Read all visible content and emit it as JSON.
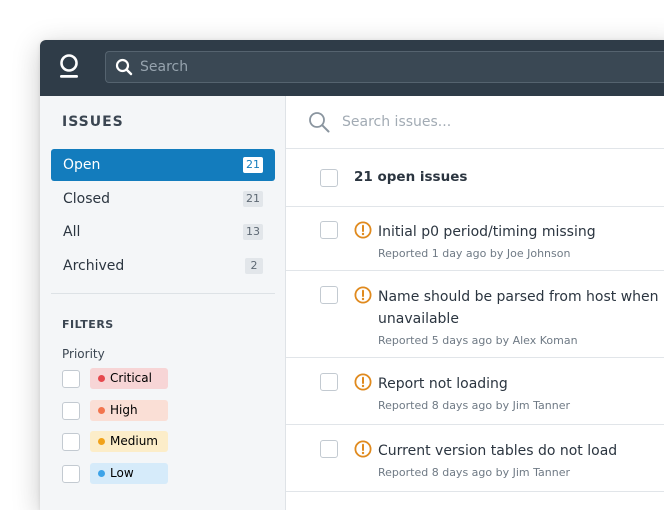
{
  "topbar": {
    "search_placeholder": "Search",
    "logo_icon": "app-logo-icon",
    "search_icon": "search-icon"
  },
  "sidebar": {
    "heading": "ISSUES",
    "nav": [
      {
        "label": "Open",
        "count": "21",
        "active": true
      },
      {
        "label": "Closed",
        "count": "21",
        "active": false
      },
      {
        "label": "All",
        "count": "13",
        "active": false
      },
      {
        "label": "Archived",
        "count": "2",
        "active": false
      }
    ],
    "filters_heading": "FILTERS",
    "priority_label": "Priority",
    "priorities": [
      {
        "label": "Critical",
        "dot_color": "#e5484d",
        "tag_bg": "#f7d5d6"
      },
      {
        "label": "High",
        "dot_color": "#f2754e",
        "tag_bg": "#fadfd6"
      },
      {
        "label": "Medium",
        "dot_color": "#f1a21a",
        "tag_bg": "#fcedc9"
      },
      {
        "label": "Low",
        "dot_color": "#3da3e8",
        "tag_bg": "#d6ebfa"
      }
    ]
  },
  "main": {
    "search_placeholder": "Search issues...",
    "list_title": "21 open issues",
    "issues": [
      {
        "title": "Initial p0 period/timing missing",
        "meta": "Reported 1 day ago by Joe Johnson"
      },
      {
        "title": "Name should be parsed from host when unavailable",
        "meta": "Reported 5 days ago by Alex Koman"
      },
      {
        "title": "Report not loading",
        "meta": "Reported 8 days ago by Jim Tanner"
      },
      {
        "title": "Current version tables do not load",
        "meta": "Reported 8 days ago by Jim Tanner"
      }
    ]
  },
  "colors": {
    "topbar_bg": "#2f3c48",
    "accent": "#137cbd",
    "warning": "#e08a1e"
  }
}
